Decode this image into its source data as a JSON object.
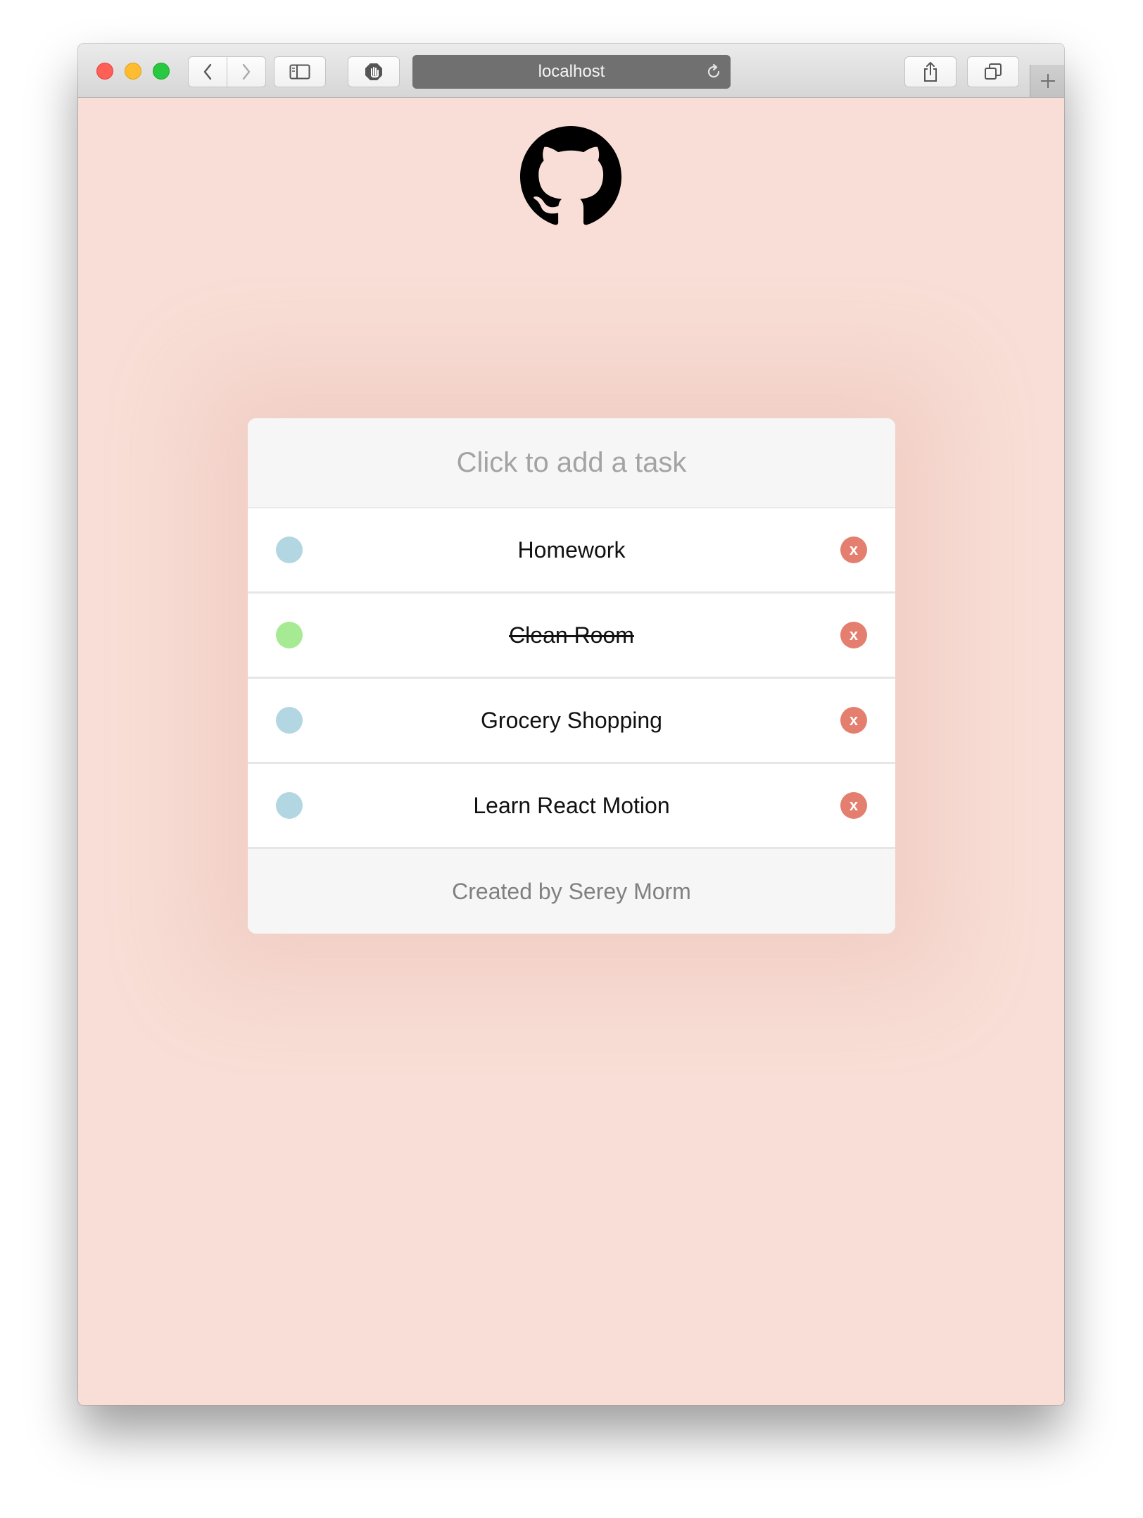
{
  "browser": {
    "url": "localhost",
    "icons": {
      "back": "chevron-left-icon",
      "forward": "chevron-right-icon",
      "sidebar": "sidebar-icon",
      "blocker": "hand-shield-icon",
      "reload": "reload-icon",
      "share": "share-icon",
      "tabs": "tabs-overview-icon",
      "new_tab": "plus-icon"
    }
  },
  "page": {
    "background_color": "#f8ded6",
    "logo": "github-icon",
    "add_task_prompt": "Click to add a task",
    "tasks": [
      {
        "label": "Homework",
        "completed": false,
        "status_color": "#b3d6e3"
      },
      {
        "label": "Clean Room",
        "completed": true,
        "status_color": "#a6eb94"
      },
      {
        "label": "Grocery Shopping",
        "completed": false,
        "status_color": "#b3d6e3"
      },
      {
        "label": "Learn React Motion",
        "completed": false,
        "status_color": "#b3d6e3"
      }
    ],
    "remove_label": "x",
    "remove_color": "#e47e6f",
    "footer": "Created by Serey Morm"
  }
}
